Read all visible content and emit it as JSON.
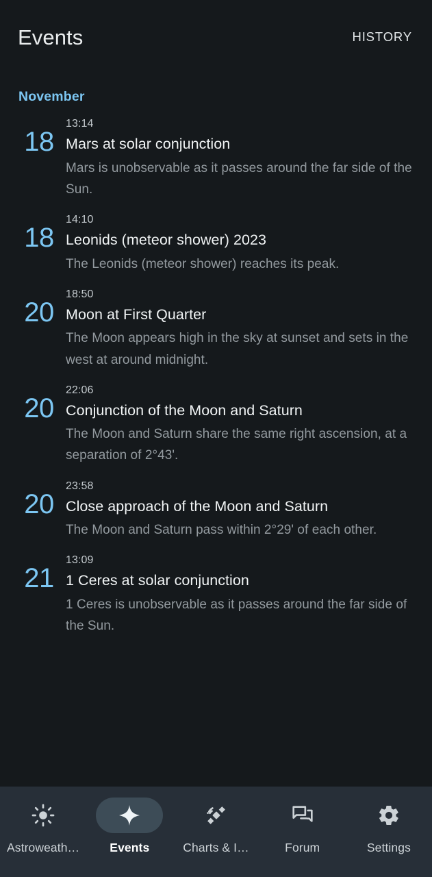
{
  "appbar": {
    "title": "Events",
    "action_label": "HISTORY"
  },
  "colors": {
    "background": "#15191c",
    "accent_blue": "#7cc6f2",
    "nav_background": "#272f38",
    "nav_active_pill": "#3d4c57",
    "title_text": "#f0f3f4",
    "desc_text": "#939a9f"
  },
  "content": {
    "month": "November",
    "events": [
      {
        "day": "18",
        "time": "13:14",
        "title": "Mars at solar conjunction",
        "description": "Mars is unobservable as it passes around the far side of the Sun."
      },
      {
        "day": "18",
        "time": "14:10",
        "title": "Leonids (meteor shower) 2023",
        "description": "The Leonids (meteor shower) reaches its peak."
      },
      {
        "day": "20",
        "time": "18:50",
        "title": "Moon at First Quarter",
        "description": "The Moon appears high in the sky at sunset and sets in the west at around midnight."
      },
      {
        "day": "20",
        "time": "22:06",
        "title": "Conjunction of the Moon and Saturn",
        "description": "The Moon and Saturn share the same right ascension, at a separation of 2°43'."
      },
      {
        "day": "20",
        "time": "23:58",
        "title": "Close approach of the Moon and Saturn",
        "description": "The Moon and Saturn pass within 2°29' of each other."
      },
      {
        "day": "21",
        "time": "13:09",
        "title": "1 Ceres at solar conjunction",
        "description": "1 Ceres is unobservable as it passes around the far side of the Sun."
      }
    ]
  },
  "bottom_nav": {
    "active_index": 1,
    "items": [
      {
        "label": "Astroweath…",
        "icon": "sun-icon"
      },
      {
        "label": "Events",
        "icon": "star-icon"
      },
      {
        "label": "Charts & I…",
        "icon": "satellite-icon"
      },
      {
        "label": "Forum",
        "icon": "chat-bubbles-icon"
      },
      {
        "label": "Settings",
        "icon": "gear-icon"
      }
    ]
  }
}
